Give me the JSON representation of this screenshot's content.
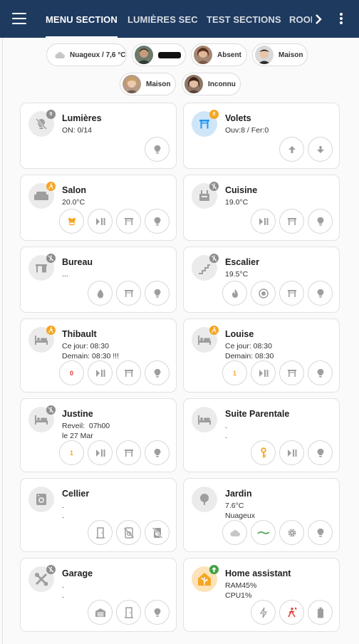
{
  "header": {
    "tabs": [
      {
        "label": "MENU SECTION"
      },
      {
        "label": "LUMIÈRES SEC"
      },
      {
        "label": "TEST SECTIONS"
      },
      {
        "label": "ROOI"
      }
    ]
  },
  "chips": {
    "weather": "Nuageux / 7,6 °C",
    "person1": "",
    "person2": "Absent",
    "person3": "Maison",
    "person4": "Maison",
    "person5": "Inconnu"
  },
  "cards": {
    "lumieres": {
      "title": "Lumières",
      "info": "ON: 0/14",
      "badge": "0"
    },
    "volets": {
      "title": "Volets",
      "info": "Ouv:8 / Fer:0",
      "badge": "0"
    },
    "salon": {
      "title": "Salon",
      "info": "20.0°C"
    },
    "cuisine": {
      "title": "Cuisine",
      "info": "19.0°C"
    },
    "bureau": {
      "title": "Bureau",
      "info": "..."
    },
    "escalier": {
      "title": "Escalier",
      "info": "19.5°C"
    },
    "thibault": {
      "title": "Thibault",
      "line1": "Ce jour: 08:30",
      "line2": "Demain: 08:30 !!!",
      "btn": "0"
    },
    "louise": {
      "title": "Louise",
      "line1": "Ce jour: 08:30",
      "line2": "Demain: 08:30",
      "btn": "1"
    },
    "justine": {
      "title": "Justine",
      "line1": "Reveil:  07h00",
      "line2": "le 27 Mar",
      "btn": "1"
    },
    "suite": {
      "title": "Suite Parentale",
      "line1": ".",
      "line2": "."
    },
    "cellier": {
      "title": "Cellier",
      "line1": ".",
      "line2": "."
    },
    "jardin": {
      "title": "Jardin",
      "line1": "7.6°C",
      "line2": "Nuageux"
    },
    "garage": {
      "title": "Garage",
      "line1": ".",
      "line2": "."
    },
    "ha": {
      "title": "Home assistant",
      "line1": "RAM45%",
      "line2": "CPU1%"
    }
  },
  "colors": {
    "header": "#1e3a5f",
    "accent_orange": "#f5a623",
    "accent_blue": "#2196f3",
    "badge_green": "#43a047"
  }
}
